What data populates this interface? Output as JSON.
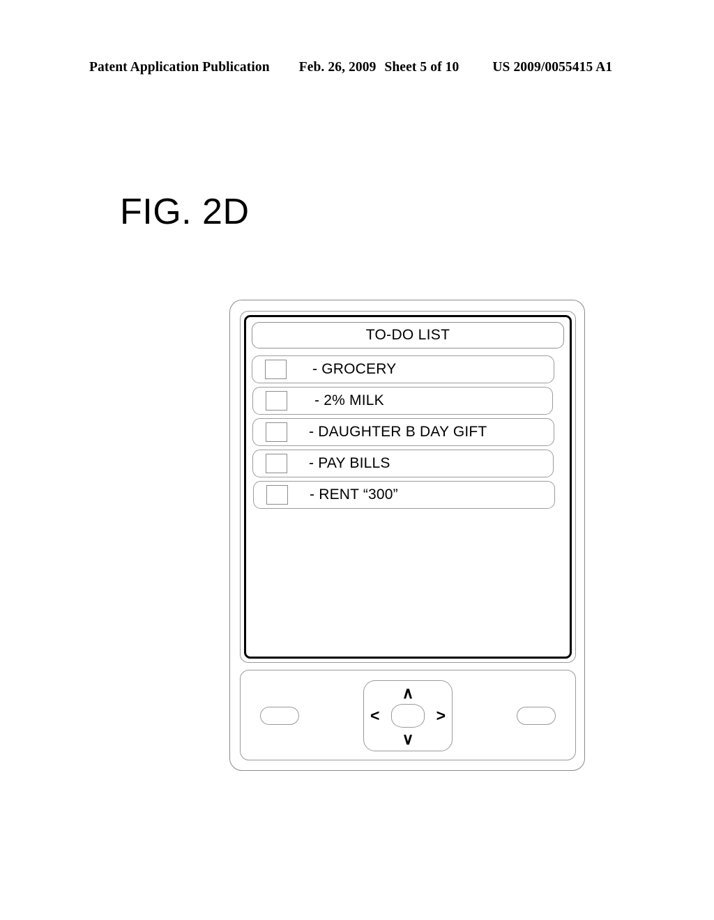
{
  "page_header": {
    "publication": "Patent Application Publication",
    "date": "Feb. 26, 2009",
    "sheet": "Sheet 5 of 10",
    "publication_number": "US 2009/0055415 A1"
  },
  "figure": {
    "label": "FIG. 2D"
  },
  "device": {
    "screen": {
      "title": "TO-DO LIST",
      "items": [
        {
          "label": "- GROCERY",
          "checked": false
        },
        {
          "label": "- 2% MILK",
          "checked": false
        },
        {
          "label": "- DAUGHTER B DAY GIFT",
          "checked": false
        },
        {
          "label": "- PAY BILLS",
          "checked": false
        },
        {
          "label": "- RENT “300”",
          "checked": false
        }
      ]
    },
    "controls": {
      "left_softkey_label": "",
      "right_softkey_label": "",
      "dpad": {
        "up": "∧",
        "down": "∨",
        "left": "<",
        "right": ">",
        "center_label": ""
      }
    }
  },
  "colors": {
    "ink": "#000000",
    "outline": "#9a9a9a",
    "screen_frame": "#000000",
    "background": "#ffffff"
  }
}
